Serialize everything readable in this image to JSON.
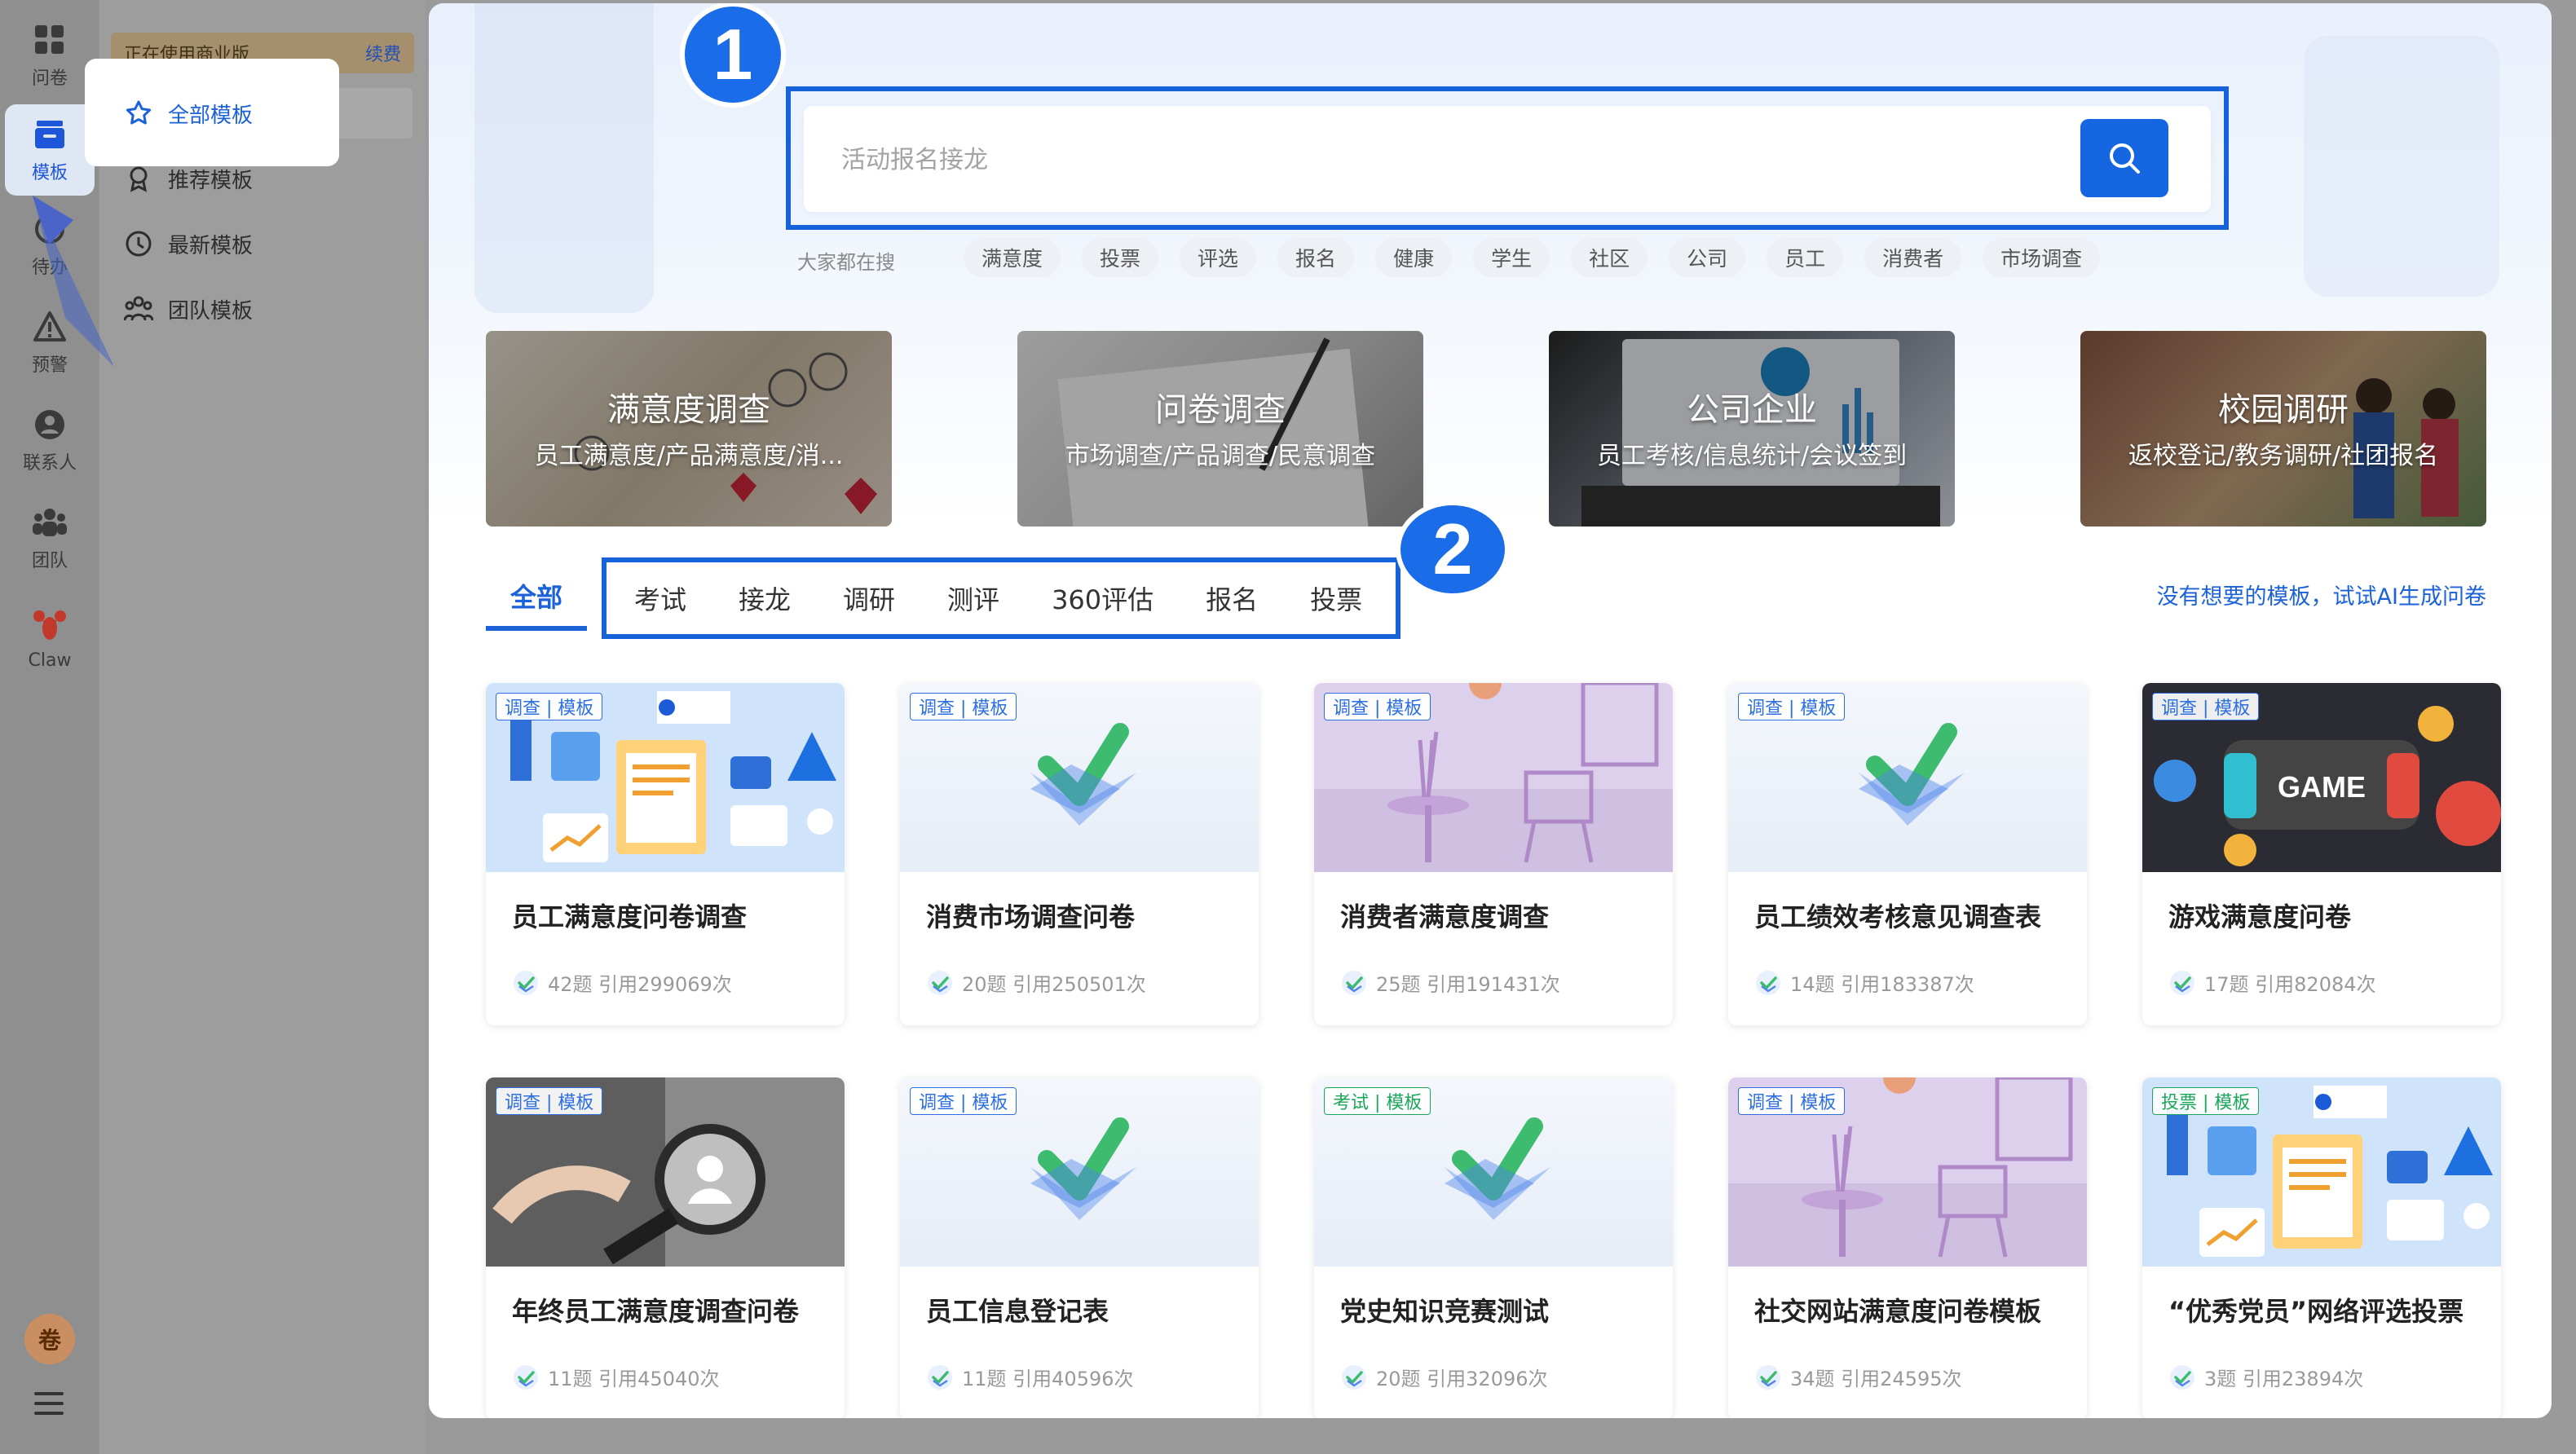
{
  "rail": {
    "items": [
      {
        "label": "问卷",
        "icon": "grid-icon"
      },
      {
        "label": "模板",
        "icon": "template-box-icon",
        "active": true
      },
      {
        "label": "待办",
        "icon": "clock-icon"
      },
      {
        "label": "预警",
        "icon": "warning-icon"
      },
      {
        "label": "联系人",
        "icon": "contact-icon"
      },
      {
        "label": "团队",
        "icon": "team-icon"
      },
      {
        "label": "Claw",
        "icon": "lobster-icon"
      }
    ],
    "avatar_text": "卷"
  },
  "sidebar": {
    "biz_text": "正在使用商业版",
    "renew_label": "续费",
    "items": [
      {
        "label": "全部模板",
        "icon": "star-icon",
        "active": true
      },
      {
        "label": "推荐模板",
        "icon": "award-icon"
      },
      {
        "label": "最新模板",
        "icon": "clock-icon"
      },
      {
        "label": "团队模板",
        "icon": "team-icon"
      }
    ]
  },
  "annotations": {
    "badge1": "1",
    "badge2": "2"
  },
  "search": {
    "placeholder": "活动报名接龙",
    "hot_label": "大家都在搜",
    "hot_tags": [
      "满意度",
      "投票",
      "评选",
      "报名",
      "健康",
      "学生",
      "社区",
      "公司",
      "员工",
      "消费者",
      "市场调查"
    ]
  },
  "banners": [
    {
      "title": "满意度调查",
      "subtitle": "员工满意度/产品满意度/消..."
    },
    {
      "title": "问卷调查",
      "subtitle": "市场调查/产品调查/民意调查"
    },
    {
      "title": "公司企业",
      "subtitle": "员工考核/信息统计/会议签到"
    },
    {
      "title": "校园调研",
      "subtitle": "返校登记/教务调研/社团报名"
    }
  ],
  "tabs": {
    "all_label": "全部",
    "items": [
      "考试",
      "接龙",
      "调研",
      "测评",
      "360评估",
      "报名",
      "投票"
    ],
    "ai_link": "没有想要的模板，试试AI生成问卷"
  },
  "cards": [
    {
      "tag": "调查 | 模板",
      "title": "员工满意度问卷调查",
      "meta": "42题 引用299069次",
      "img": "office"
    },
    {
      "tag": "调查 | 模板",
      "title": "消费市场调查问卷",
      "meta": "20题 引用250501次",
      "img": "check"
    },
    {
      "tag": "调查 | 模板",
      "title": "消费者满意度调查",
      "meta": "25题 引用191431次",
      "img": "room"
    },
    {
      "tag": "调查 | 模板",
      "title": "员工绩效考核意见调查表",
      "meta": "14题 引用183387次",
      "img": "check"
    },
    {
      "tag": "调查 | 模板",
      "title": "游戏满意度问卷",
      "meta": "17题 引用82084次",
      "img": "game"
    },
    {
      "tag": "调查 | 模板",
      "title": "年终员工满意度调查问卷",
      "meta": "11题 引用45040次",
      "img": "magnifier"
    },
    {
      "tag": "调查 | 模板",
      "title": "员工信息登记表",
      "meta": "11题 引用40596次",
      "img": "check"
    },
    {
      "tag": "考试 | 模板",
      "title": "党史知识竞赛测试",
      "meta": "20题 引用32096次",
      "img": "check"
    },
    {
      "tag": "调查 | 模板",
      "title": "社交网站满意度问卷模板",
      "meta": "34题 引用24595次",
      "img": "room"
    },
    {
      "tag": "投票 | 模板",
      "title": "“优秀党员”网络评选投票",
      "meta": "3题 引用23894次",
      "img": "office"
    }
  ],
  "colors": {
    "accent": "#1566e0",
    "exam_tag": "#1ca65a",
    "biz_bar": "#a58f6c"
  }
}
